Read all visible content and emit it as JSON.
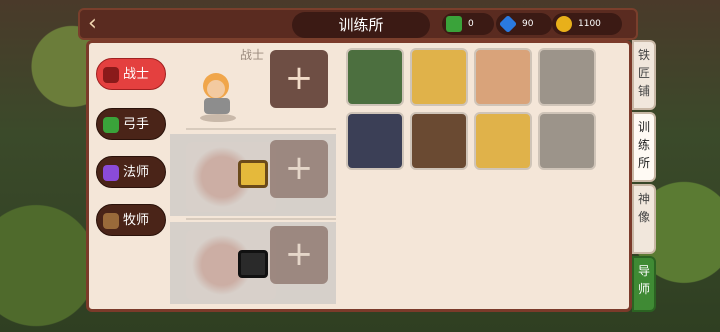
{
  "header": {
    "title": "训练所",
    "resources": [
      {
        "name": "book-icon",
        "value": "0",
        "color": "#3aa33a"
      },
      {
        "name": "diamond-icon",
        "value": "90",
        "color": "#2a7ae0"
      },
      {
        "name": "gold-coin-icon",
        "value": "1100",
        "color": "#e8b01a"
      }
    ]
  },
  "classes": [
    {
      "label": "战士",
      "icon": "warrior-icon",
      "active": true
    },
    {
      "label": "弓手",
      "icon": "archer-icon",
      "active": false
    },
    {
      "label": "法师",
      "icon": "mage-icon",
      "active": false
    },
    {
      "label": "牧师",
      "icon": "priest-icon",
      "active": false
    }
  ],
  "slots": {
    "slot1_label": "战士",
    "plus": "+"
  },
  "side_tabs": [
    {
      "label": "铁匠铺",
      "active": false
    },
    {
      "label": "训练所",
      "active": true
    },
    {
      "label": "神像",
      "active": false
    },
    {
      "label": "导师",
      "active": false,
      "guide": true
    }
  ],
  "portraits": [
    {
      "name": "portrait-green-hair-woman",
      "color": "#4c6f3f"
    },
    {
      "name": "portrait-blonde-girl",
      "color": "#e0b24a"
    },
    {
      "name": "portrait-bald-monk",
      "color": "#d9a37a"
    },
    {
      "name": "portrait-grey-hair-elder",
      "color": "#9c948a"
    },
    {
      "name": "portrait-dark-hair-warrior",
      "color": "#3b3f56"
    },
    {
      "name": "portrait-bearded-man",
      "color": "#6a4a32"
    },
    {
      "name": "portrait-blonde-girl-2",
      "color": "#e0b24a"
    },
    {
      "name": "portrait-grey-hair-elder-2",
      "color": "#9c948a"
    }
  ]
}
